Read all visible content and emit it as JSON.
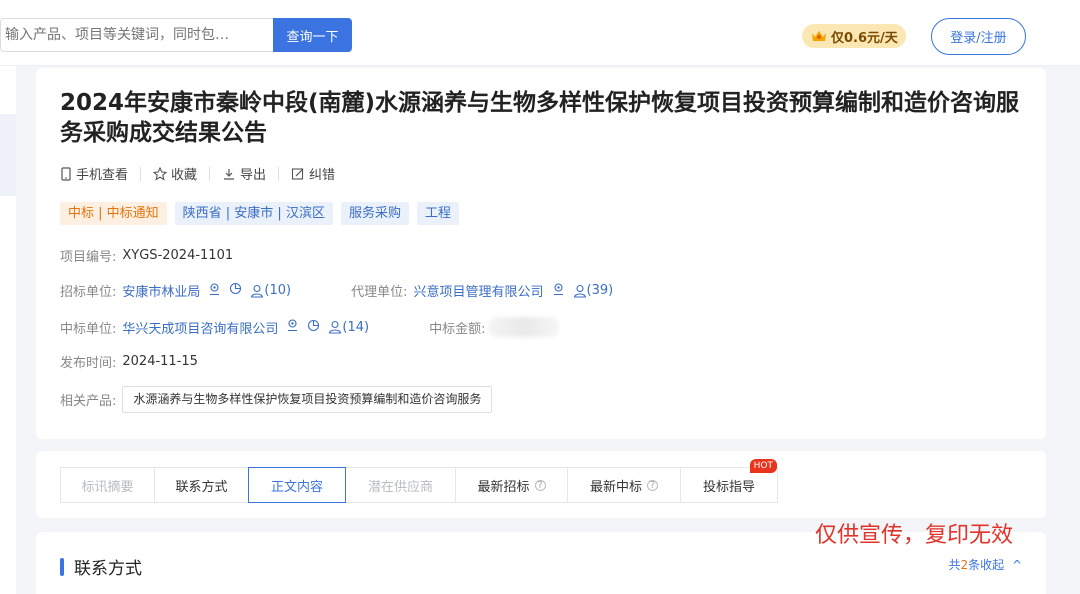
{
  "header": {
    "search_placeholder": "输入产品、项目等关键词，同时包…",
    "search_button": "查询一下",
    "vip_label": "仅0.6元/天",
    "login_label": "登录/注册"
  },
  "notice": {
    "title": "2024年安康市秦岭中段(南麓)水源涵养与生物多样性保护恢复项目投资预算编制和造价咨询服务采购成交结果公告",
    "actions": [
      "手机查看",
      "收藏",
      "导出",
      "纠错"
    ],
    "tags": [
      {
        "label": "中标 | 中标通知",
        "color": "orange"
      },
      {
        "label": "陕西省 | 安康市 | 汉滨区",
        "color": "blue"
      },
      {
        "label": "服务采购",
        "color": "blue"
      },
      {
        "label": "工程",
        "color": "blue"
      }
    ],
    "project_no_label": "项目编号:",
    "project_no": "XYGS-2024-1101",
    "tenderer_label": "招标单位:",
    "tenderer": "安康市林业局",
    "tenderer_count": "(10)",
    "agent_label": "代理单位:",
    "agent": "兴意项目管理有限公司",
    "agent_count": "(39)",
    "winner_label": "中标单位:",
    "winner": "华兴天成项目咨询有限公司",
    "winner_count": "(14)",
    "amount_label": "中标金额:",
    "publish_label": "发布时间:",
    "publish_date": "2024-11-15",
    "product_label": "相关产品:",
    "product": "水源涵养与生物多样性保护恢复项目投资预算编制和造价咨询服务"
  },
  "tabs": [
    {
      "label": "标讯摘要",
      "state": "dim"
    },
    {
      "label": "联系方式",
      "state": "normal"
    },
    {
      "label": "正文内容",
      "state": "active"
    },
    {
      "label": "潜在供应商",
      "state": "dim"
    },
    {
      "label": "最新招标",
      "state": "help"
    },
    {
      "label": "最新中标",
      "state": "help"
    },
    {
      "label": "投标指导",
      "state": "hot"
    }
  ],
  "hot_badge": "HOT",
  "help_glyph": "?",
  "watermark": "仅供宣传，复印无效",
  "contact": {
    "title": "联系方式",
    "collapse_prefix": "共",
    "collapse_count": "2",
    "collapse_suffix": "条收起",
    "collapse_arrow": "^"
  },
  "colors": {
    "primary": "#3b74e0",
    "link": "#3b6ec4",
    "orange": "#e8730d",
    "watermark": "#e0332a",
    "hot": "#e8341c"
  }
}
